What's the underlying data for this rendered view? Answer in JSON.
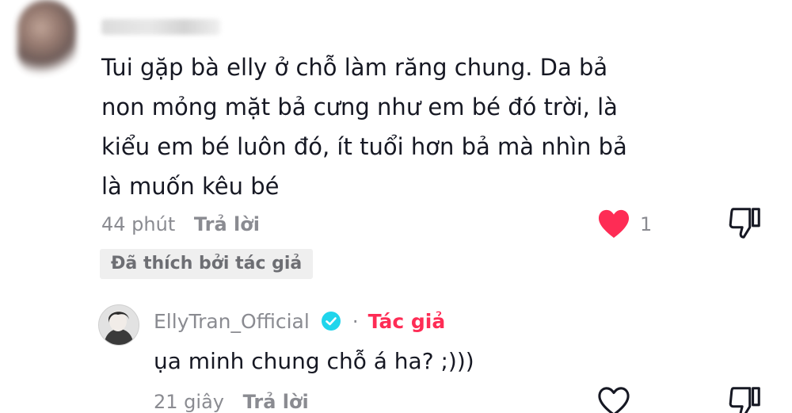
{
  "comment": {
    "text": "Tui gặp bà elly ở chỗ làm răng chung. Da bả\nnon mỏng mặt bả cưng như em bé đó trời, là\nkiểu em bé luôn đó, ít tuổi hơn bả mà nhìn bả\nlà muốn kêu bé",
    "time": "44 phút",
    "reply_label": "Trả lời",
    "like_count": "1",
    "liked": true,
    "liked_by_author_badge": "Đã thích bởi tác giả"
  },
  "reply": {
    "username": "EllyTran_Official",
    "separator": "·",
    "author_tag": "Tác giả",
    "text": "ụa minh chung chỗ á ha? ;)))",
    "time": "21 giây",
    "reply_label": "Trả lời",
    "liked": false
  },
  "icons": {
    "heart_filled": "heart-filled-icon",
    "heart_outline": "heart-outline-icon",
    "dislike": "thumbs-down-icon",
    "verified": "verified-check-icon"
  },
  "colors": {
    "heart_red": "#fe2c55",
    "author_pink": "#fe2c55",
    "verified_blue": "#20d5ec",
    "text_primary": "#161823",
    "text_secondary": "#8a8b91"
  }
}
